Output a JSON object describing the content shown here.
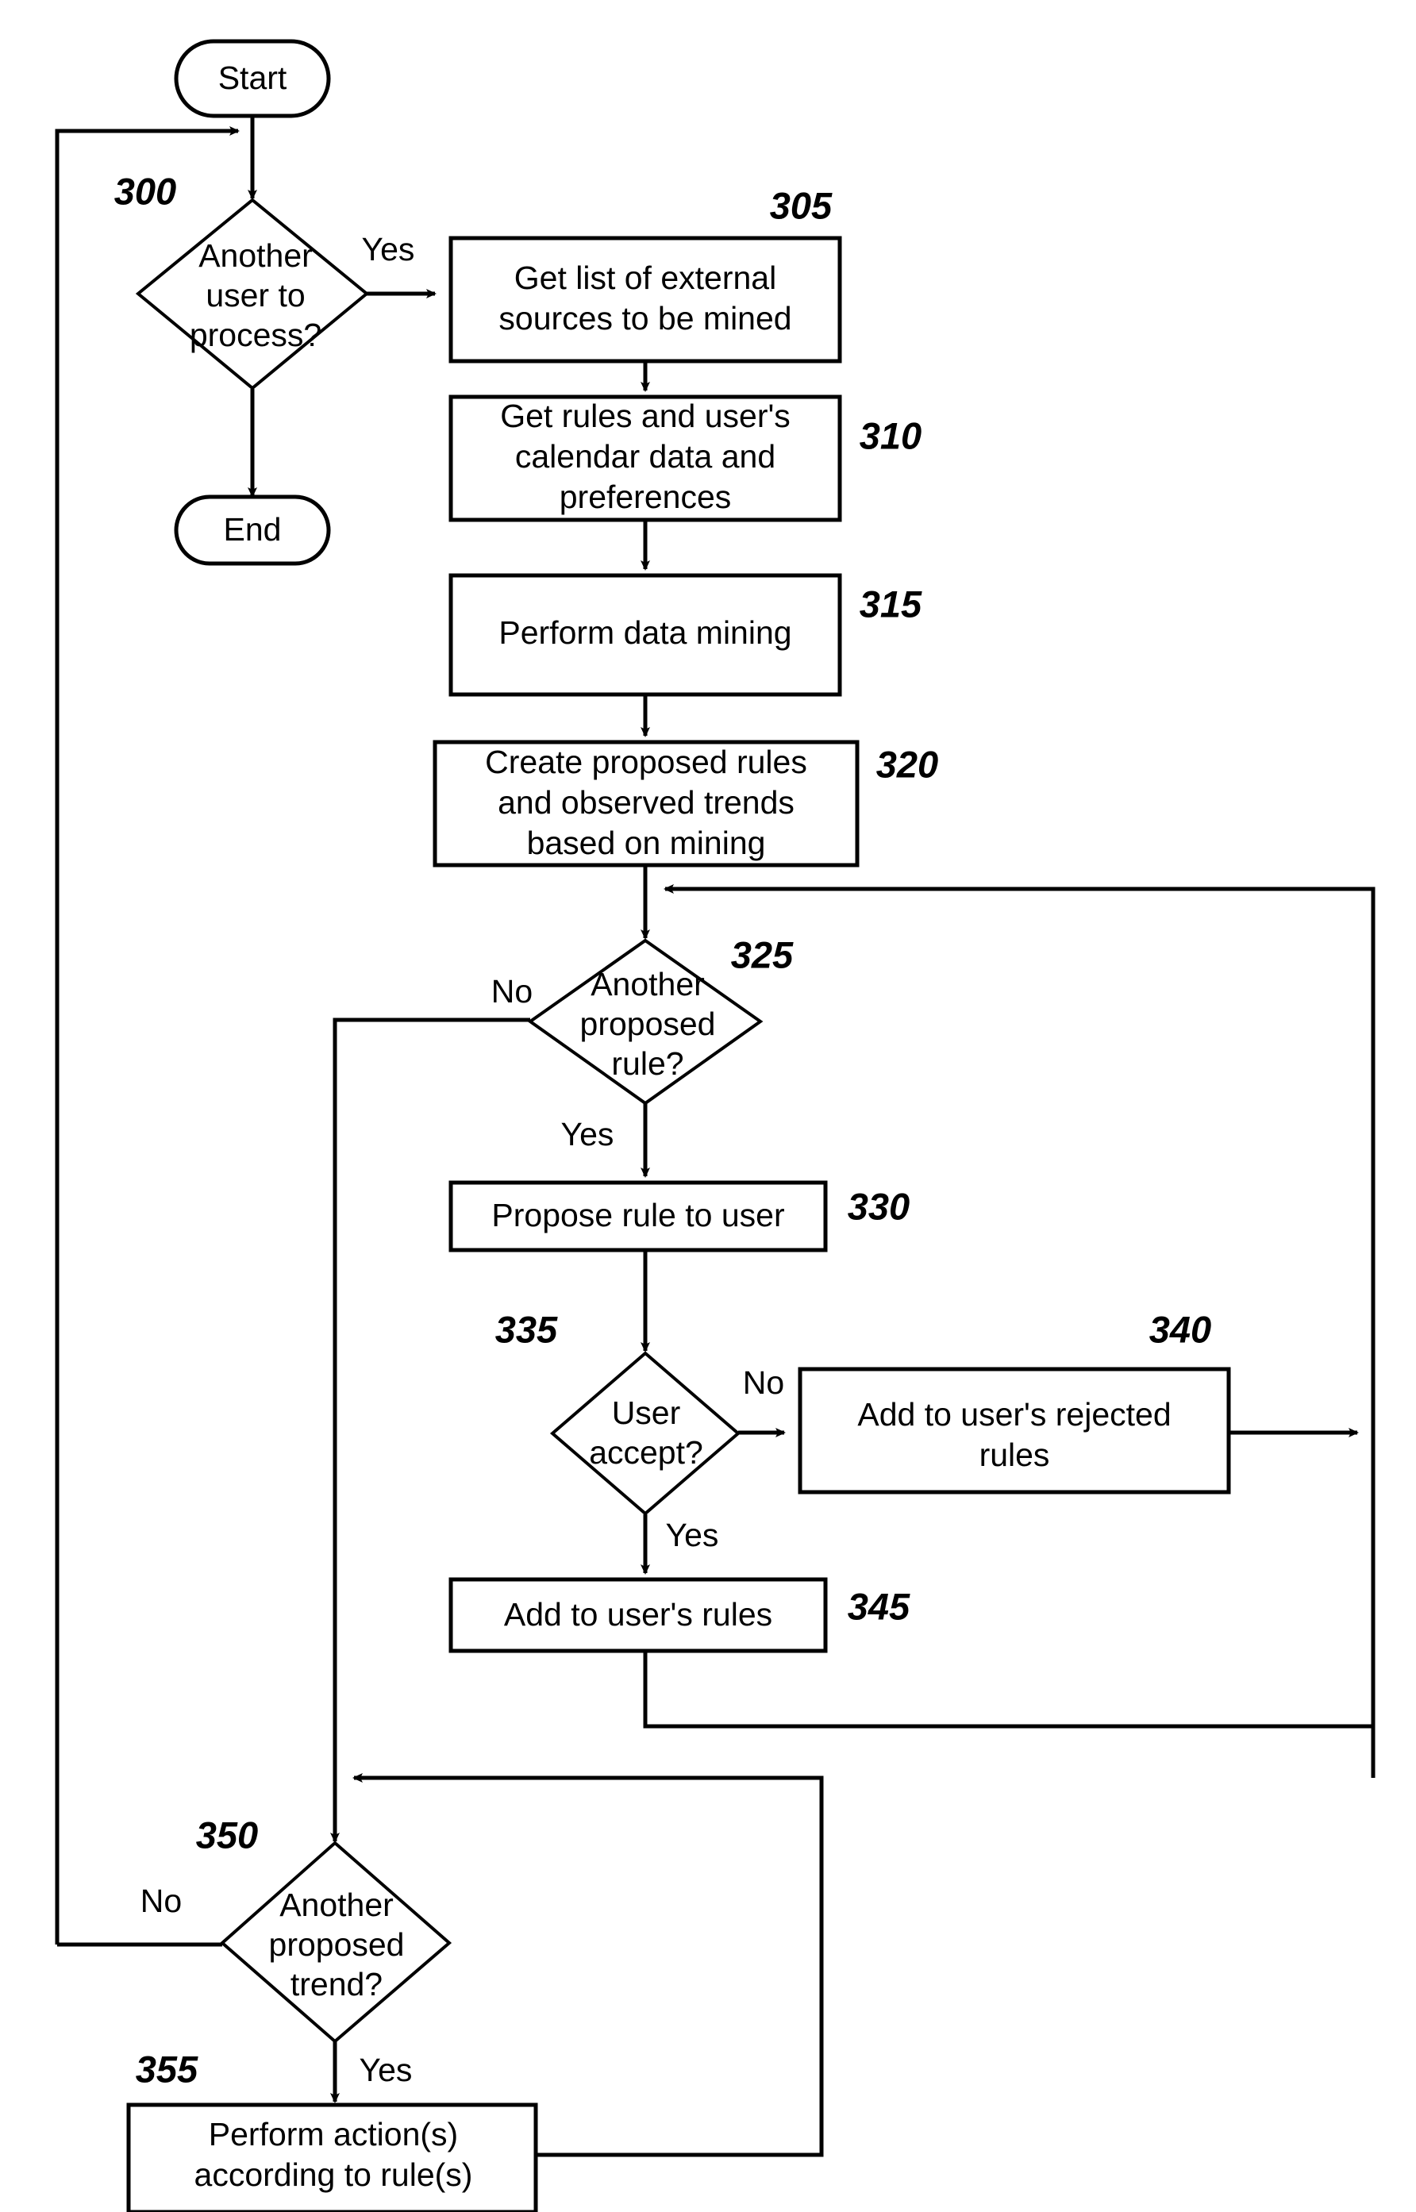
{
  "diagram": {
    "type": "flowchart",
    "title": "",
    "nodes": {
      "start": {
        "label": "Start",
        "shape": "terminator"
      },
      "end": {
        "label": "End",
        "shape": "terminator"
      },
      "n300": {
        "ref": "300",
        "shape": "decision",
        "lines": [
          "Another",
          "user to",
          "process?"
        ]
      },
      "n305": {
        "ref": "305",
        "shape": "process",
        "lines": [
          "Get list of external",
          "sources to be mined"
        ]
      },
      "n310": {
        "ref": "310",
        "shape": "process",
        "lines": [
          "Get rules and user's",
          "calendar data and",
          "preferences"
        ]
      },
      "n315": {
        "ref": "315",
        "shape": "process",
        "lines": [
          "Perform data mining"
        ]
      },
      "n320": {
        "ref": "320",
        "shape": "process",
        "lines": [
          "Create proposed rules",
          "and observed trends",
          "based on mining"
        ]
      },
      "n325": {
        "ref": "325",
        "shape": "decision",
        "lines": [
          "Another",
          "proposed",
          "rule?"
        ]
      },
      "n330": {
        "ref": "330",
        "shape": "process",
        "lines": [
          "Propose rule to user"
        ]
      },
      "n335": {
        "ref": "335",
        "shape": "decision",
        "lines": [
          "User",
          "accept?"
        ]
      },
      "n340": {
        "ref": "340",
        "shape": "process",
        "lines": [
          "Add to user's rejected",
          "rules"
        ]
      },
      "n345": {
        "ref": "345",
        "shape": "process",
        "lines": [
          "Add to user's rules"
        ]
      },
      "n350": {
        "ref": "350",
        "shape": "decision",
        "lines": [
          "Another",
          "proposed",
          "trend?"
        ]
      },
      "n355": {
        "ref": "355",
        "shape": "process",
        "lines": [
          "Perform action(s)",
          "according to rule(s)"
        ]
      }
    },
    "edge_labels": {
      "e300_yes": "Yes",
      "e300_no": "",
      "e325_no": "No",
      "e325_yes": "Yes",
      "e335_no": "No",
      "e335_yes": "Yes",
      "e350_no": "No",
      "e350_yes": "Yes"
    },
    "colors": {
      "stroke": "#000000",
      "fill": "#ffffff",
      "text": "#000000"
    }
  }
}
